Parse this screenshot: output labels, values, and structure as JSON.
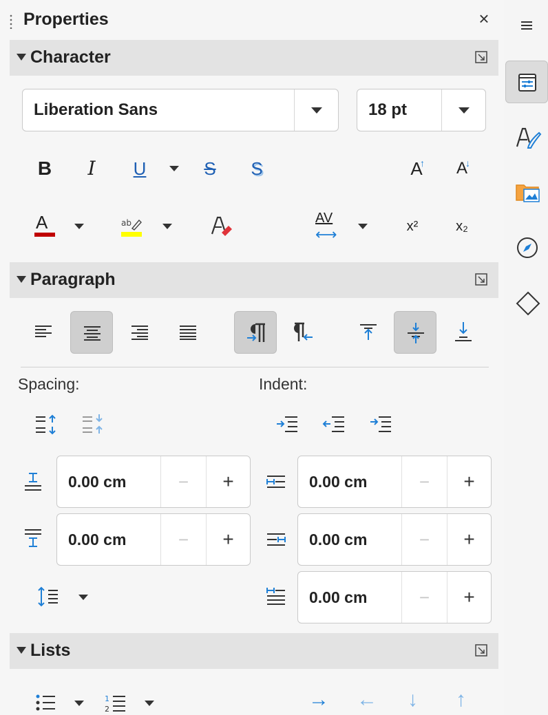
{
  "panel": {
    "title": "Properties",
    "close_glyph": "×"
  },
  "sections": {
    "character": "Character",
    "paragraph": "Paragraph",
    "lists": "Lists"
  },
  "character": {
    "font_name": "Liberation Sans",
    "font_size": "18 pt",
    "bold_glyph": "B",
    "italic_glyph": "I",
    "underline_glyph": "U",
    "strike_glyph": "S",
    "shadow_glyph": "S",
    "grow_glyph": "A",
    "shrink_glyph": "A",
    "font_color_glyph": "A",
    "superscript_glyph": "x²",
    "subscript_glyph": "x₂",
    "spacing_glyph": "AV",
    "font_color": "#c00000",
    "highlight_color": "#ffff00"
  },
  "paragraph": {
    "spacing_label": "Spacing:",
    "indent_label": "Indent:",
    "above_spacing": "0.00 cm",
    "below_spacing": "0.00 cm",
    "before_indent": "0.00 cm",
    "after_indent": "0.00 cm",
    "first_line_indent": "0.00 cm",
    "minus_glyph": "−",
    "plus_glyph": "+"
  },
  "colors": {
    "accent": "#1e7fd6",
    "active_bg": "#cfcfcf"
  },
  "icons": {
    "sidebar": [
      "hamburger-menu-icon",
      "properties-icon",
      "styles-icon",
      "gallery-icon",
      "navigator-icon",
      "shapes-icon"
    ]
  }
}
